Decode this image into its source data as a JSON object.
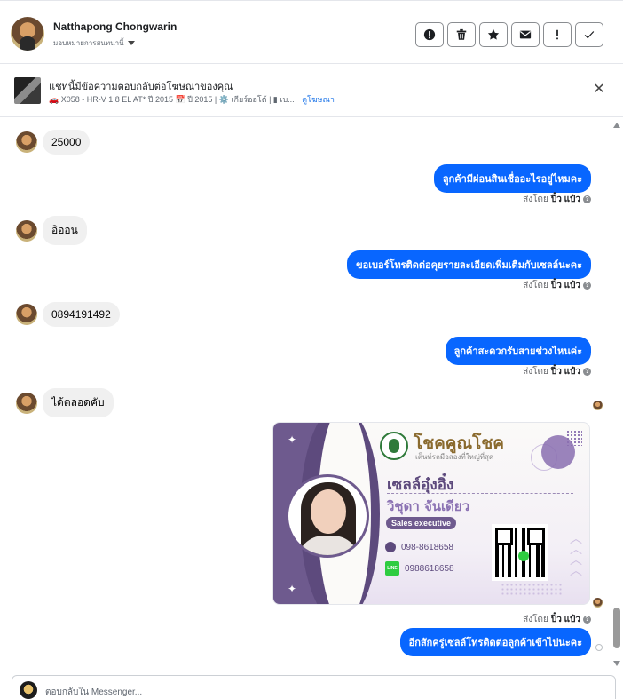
{
  "header": {
    "name": "Natthapong Chongwarin",
    "assign_label": "มอบหมายการสนทนานี้",
    "actions": [
      {
        "name": "spam-button",
        "icon": "alert-circle-icon"
      },
      {
        "name": "delete-button",
        "icon": "trash-icon"
      },
      {
        "name": "star-button",
        "icon": "star-icon"
      },
      {
        "name": "mark-unread-button",
        "icon": "envelope-icon"
      },
      {
        "name": "follow-up-button",
        "icon": "exclamation-icon"
      },
      {
        "name": "mark-done-button",
        "icon": "check-icon"
      }
    ]
  },
  "ad": {
    "title": "แชทนี้มีข้อความตอบกลับต่อโฆษณาของคุณ",
    "details": "🚗 X058 - HR-V 1.8 EL AT* ปี 2015 📅 ปี 2015 | ⚙️ เกียร์ออโต้ | ▮ เบ...",
    "link": "ดูโฆษณา"
  },
  "messages": {
    "in1": "25000",
    "out1": "ลูกค้ามีผ่อนสินเชื่ออะไรอยู่ไหมคะ",
    "in2": "อิออน",
    "out2": "ขอเบอร์โทรติดต่อคุยรายละเอียดเพิ่มเติมกับเซลล์นะคะ",
    "in3": "0894191492",
    "out3": "ลูกค้าสะดวกรับสายช่วงไหนค่ะ",
    "in4": "ได้ตลอดคับ",
    "out4": "อีกสักครู่เซลล์โทรติดต่อลูกค้าเข้าไปนะคะ"
  },
  "sent_by": {
    "prefix": "ส่งโดย",
    "sender": "ปิ๋ว แป๋ว"
  },
  "card": {
    "brand": "โชคคูณโชค",
    "slogan": "เต็นท์รถมือสองที่ใหญ่ที่สุด",
    "nickname": "เซลล์อุ๋งอิ๋ง",
    "full_name": "วิชุดา จันเดียว",
    "role": "Sales executive",
    "phone": "098-8618658",
    "line_label": "LINE",
    "line_id": "0988618658"
  },
  "reply": {
    "placeholder": "ตอบกลับใน Messenger..."
  }
}
